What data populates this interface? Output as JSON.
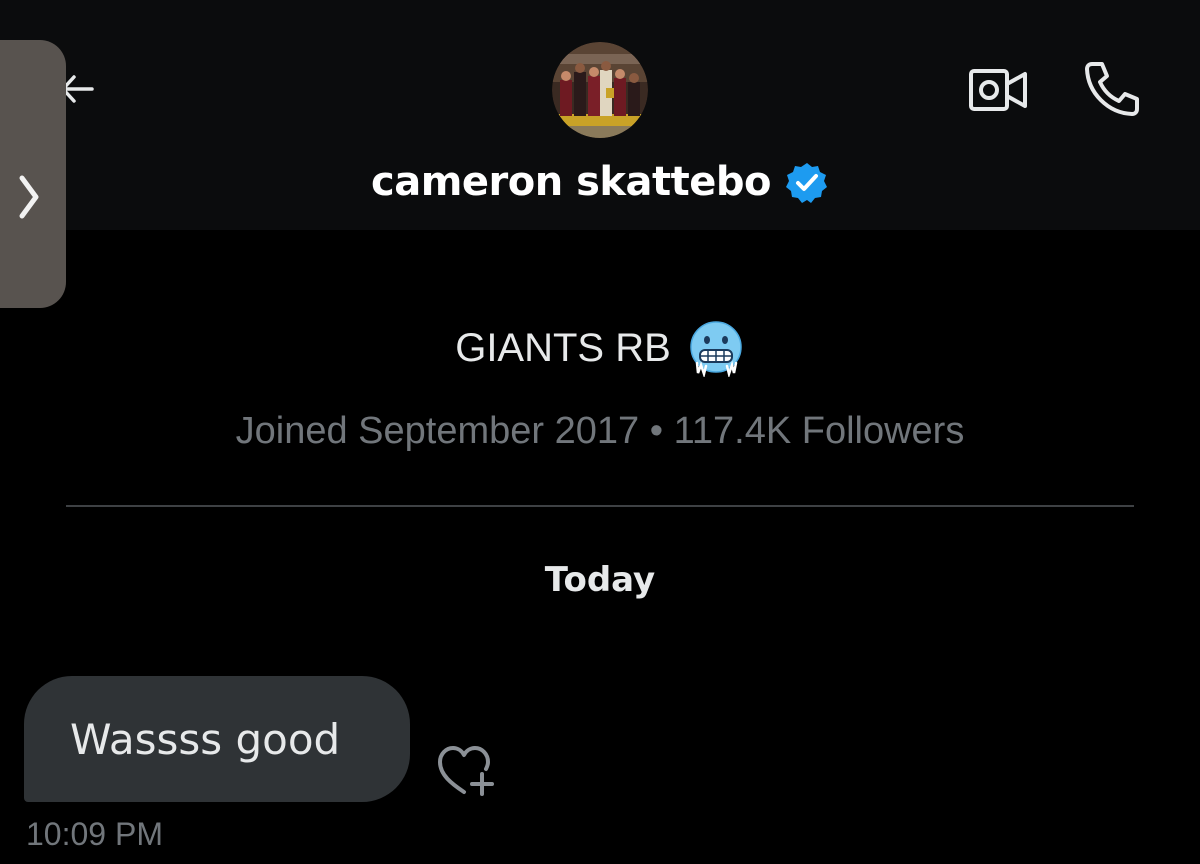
{
  "header": {
    "display_name": "cameron skattebo",
    "verified": true,
    "accent_color": "#1d9bf0",
    "icons": [
      "back-arrow-icon",
      "video-call-icon",
      "phone-icon",
      "verified-badge-icon"
    ]
  },
  "profile": {
    "bio": "GIANTS RB",
    "bio_emoji": "cold-face-emoji",
    "meta": "Joined September 2017 • 117.4K Followers"
  },
  "conversation": {
    "day_label": "Today",
    "messages": [
      {
        "text": "Wassss good",
        "time": "10:09 PM"
      }
    ]
  },
  "overlay": {
    "side_handle_icon": "chevron-right-icon"
  }
}
